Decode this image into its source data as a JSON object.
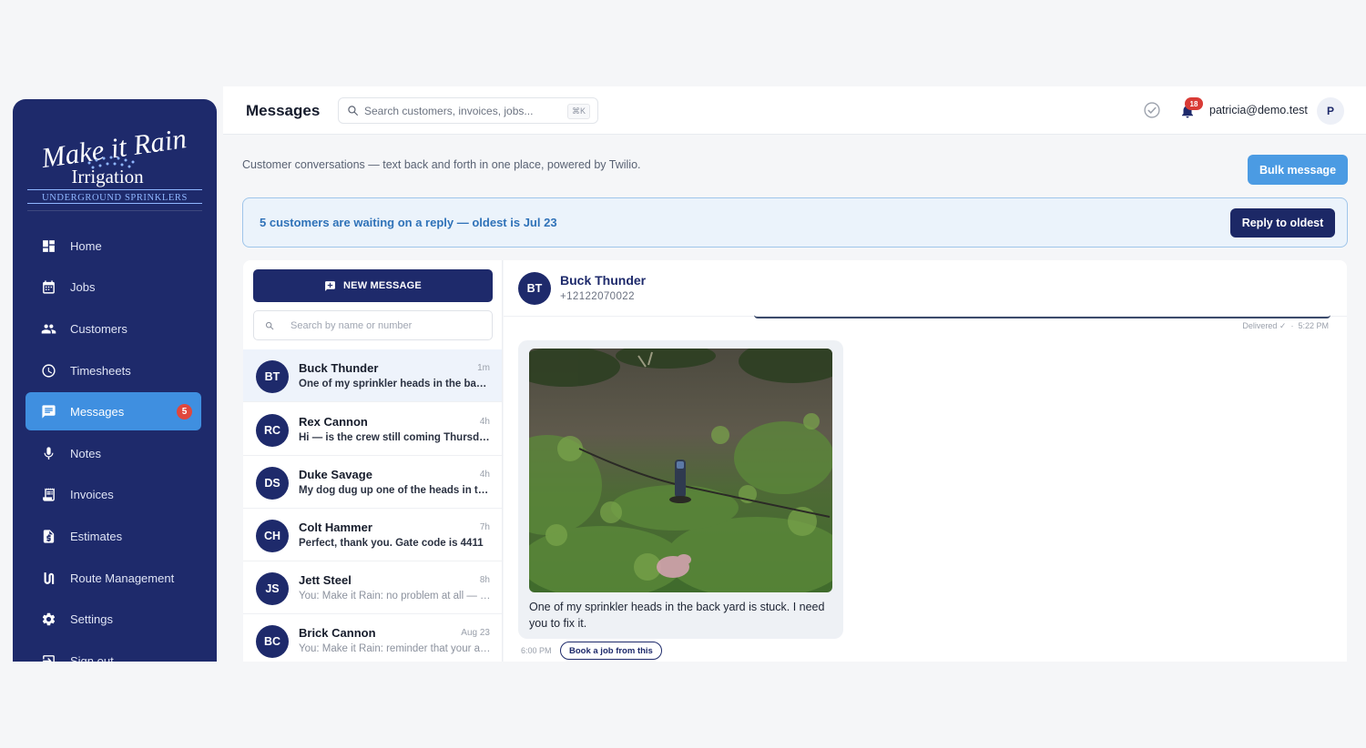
{
  "brand": {
    "logo_line1": "Make it Rain",
    "logo_line2": "Irrigation",
    "logo_line3": "UNDERGROUND SPRINKLERS",
    "color_primary": "#1e2a6b",
    "color_accent": "#3f8fe0"
  },
  "sidebar": {
    "items": [
      {
        "label": "Home",
        "icon": "dashboard-icon",
        "active": false
      },
      {
        "label": "Jobs",
        "icon": "calendar-icon",
        "active": false
      },
      {
        "label": "Customers",
        "icon": "people-icon",
        "active": false
      },
      {
        "label": "Timesheets",
        "icon": "clock-icon",
        "active": false
      },
      {
        "label": "Messages",
        "icon": "chat-icon",
        "active": true,
        "badge": "5"
      },
      {
        "label": "Notes",
        "icon": "microphone-icon",
        "active": false
      },
      {
        "label": "Invoices",
        "icon": "invoice-icon",
        "active": false
      },
      {
        "label": "Estimates",
        "icon": "estimate-doc-icon",
        "active": false
      },
      {
        "label": "Route Management",
        "icon": "route-icon",
        "active": false
      },
      {
        "label": "Settings",
        "icon": "gear-icon",
        "active": false
      },
      {
        "label": "Sign out",
        "icon": "sign-out-icon",
        "active": false
      }
    ]
  },
  "header": {
    "title": "Messages",
    "search_placeholder": "Search customers, invoices, jobs...",
    "search_shortcut": "⌘K",
    "notification_count": "18",
    "user_email": "patricia@demo.test",
    "user_initial": "P"
  },
  "page": {
    "subtitle": "Customer conversations — text back and forth in one place, powered by Twilio.",
    "bulk_button": "Bulk message",
    "banner_text": "5 customers are waiting on a reply — oldest is Jul 23",
    "reply_button": "Reply to oldest"
  },
  "list": {
    "new_message_label": "NEW MESSAGE",
    "search_placeholder": "Search by name or number",
    "conversations": [
      {
        "initials": "BT",
        "name": "Buck Thunder",
        "time": "1m",
        "preview": "One of my sprinkler heads in the back yard is stuck. I need you to fix it.",
        "unread": true,
        "selected": true
      },
      {
        "initials": "RC",
        "name": "Rex Cannon",
        "time": "4h",
        "preview": "Hi — is the crew still coming Thursday?",
        "unread": true,
        "selected": false
      },
      {
        "initials": "DS",
        "name": "Duke Savage",
        "time": "4h",
        "preview": "My dog dug up one of the heads in the front yard",
        "unread": true,
        "selected": false
      },
      {
        "initials": "CH",
        "name": "Colt Hammer",
        "time": "7h",
        "preview": "Perfect, thank you. Gate code is 4411",
        "unread": true,
        "selected": false
      },
      {
        "initials": "JS",
        "name": "Jett Steel",
        "time": "8h",
        "preview": "You: Make it Rain: no problem at all — see you soon",
        "unread": false,
        "selected": false
      },
      {
        "initials": "BC",
        "name": "Brick Cannon",
        "time": "Aug 23",
        "preview": "You: Make it Rain: reminder that your appointment is tomorrow",
        "unread": false,
        "selected": false
      }
    ]
  },
  "thread": {
    "initials": "BT",
    "name": "Buck Thunder",
    "phone": "+12122070022",
    "delivered_status": "Delivered ✓",
    "delivered_time": "5:22 PM",
    "message_text": "One of my sprinkler heads in the back yard is stuck. I need you to fix it.",
    "message_time": "6:00 PM",
    "book_button": "Book a job from this"
  }
}
